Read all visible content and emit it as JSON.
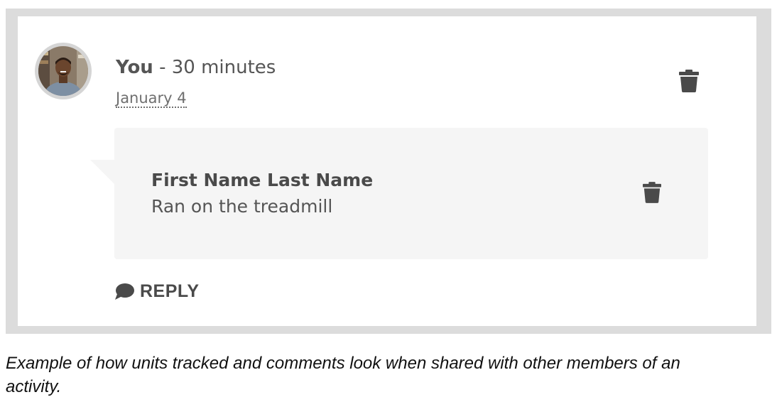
{
  "comment": {
    "author": "You",
    "separator": " - ",
    "units": "30 minutes",
    "date": "January 4",
    "delete_icon": "trash-icon"
  },
  "reply": {
    "name": "First Name Last Name",
    "text": "Ran on the treadmill",
    "delete_icon": "trash-icon"
  },
  "reply_button": {
    "label": "REPLY",
    "icon": "speech-bubble-icon"
  },
  "caption": "Example of how units tracked and comments look when shared with other members of an activity.",
  "colors": {
    "frame": "#dcdcdc",
    "reply_background": "#f5f5f5",
    "text": "#555555",
    "icon": "#4a4a4a"
  }
}
